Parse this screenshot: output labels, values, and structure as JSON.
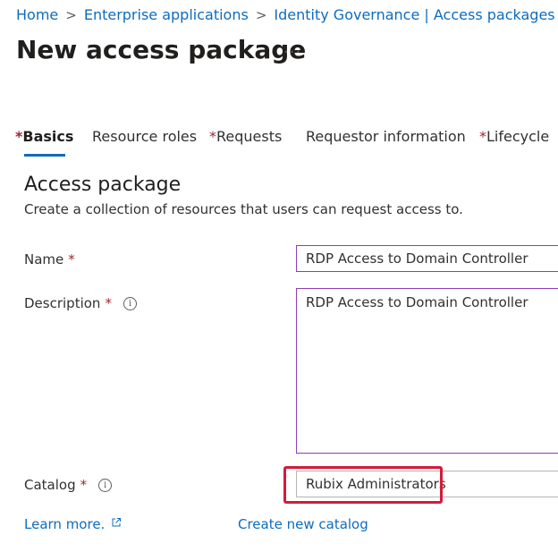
{
  "breadcrumb": {
    "items": [
      "Home",
      "Enterprise applications",
      "Identity Governance | Access packages"
    ]
  },
  "page": {
    "title": "New access package",
    "more_label": "···"
  },
  "tabs": [
    {
      "label": "Basics",
      "required": "*",
      "active": true
    },
    {
      "label": "Resource roles",
      "required": "",
      "active": false
    },
    {
      "label": "Requests",
      "required": "*",
      "active": false
    },
    {
      "label": "Requestor information",
      "required": "",
      "active": false
    },
    {
      "label": "Lifecycle",
      "required": "*",
      "active": false
    }
  ],
  "section": {
    "title": "Access package",
    "subtitle": "Create a collection of resources that users can request access to."
  },
  "form": {
    "name_label": "Name",
    "name_value": "RDP Access to Domain Controller",
    "description_label": "Description",
    "description_value": "RDP Access to Domain Controller",
    "catalog_label": "Catalog",
    "catalog_value": "Rubix Administrators",
    "required_mark": "*",
    "info_glyph": "i"
  },
  "links": {
    "learn_more": "Learn more.",
    "create_catalog": "Create new catalog"
  },
  "colors": {
    "link": "#0f6cbd",
    "required": "#a4262c",
    "active_field_border": "#8a3fb8",
    "highlight": "#d51a3a"
  }
}
